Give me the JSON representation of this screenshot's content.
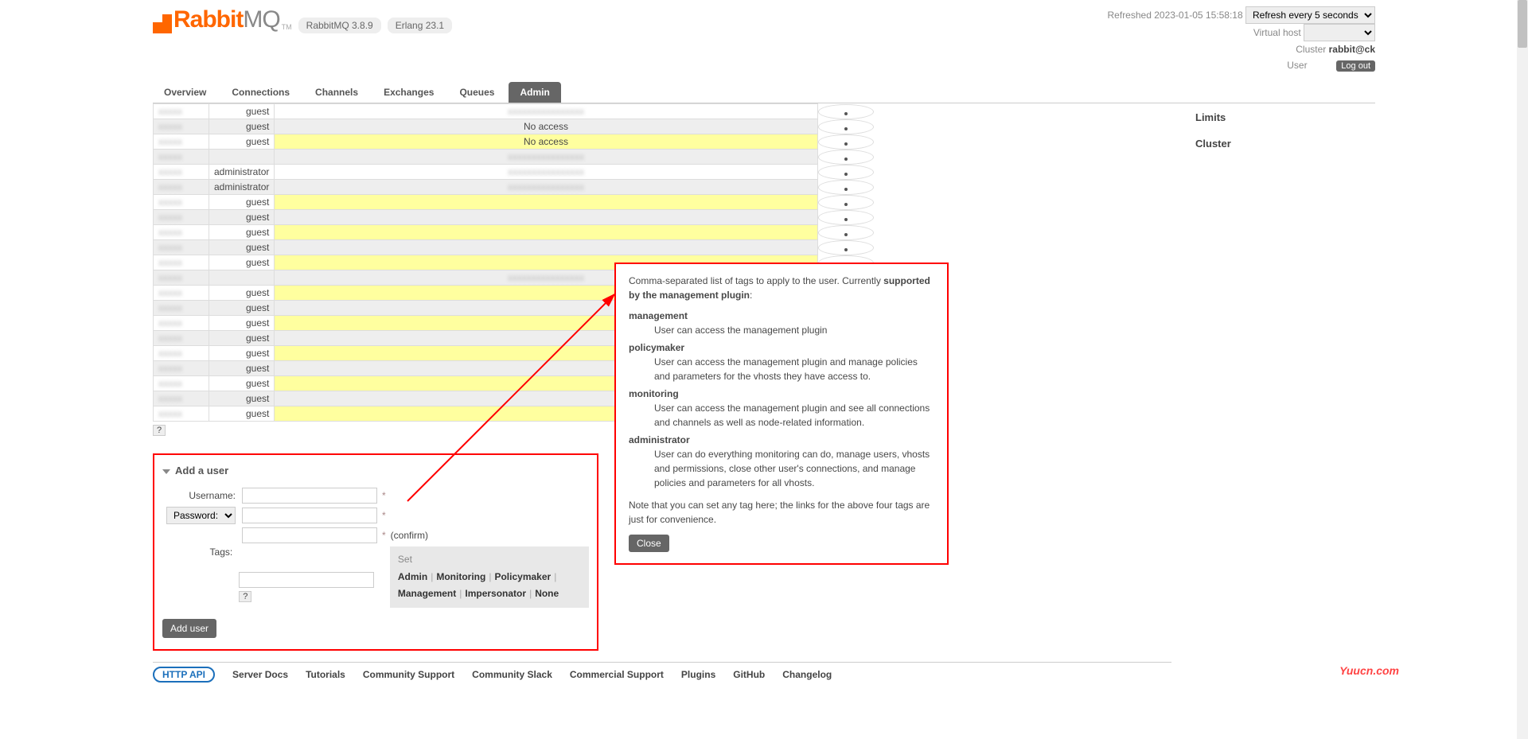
{
  "header": {
    "logo1": "Rabbit",
    "logo2": "MQ",
    "tm": "TM",
    "version": "RabbitMQ 3.8.9",
    "erlang": "Erlang 23.1"
  },
  "status": {
    "refreshed": "Refreshed 2023-01-05 15:58:18",
    "refresh_option": "Refresh every 5 seconds",
    "vhost_label": "Virtual host",
    "vhost_value": " ",
    "cluster_label": "Cluster",
    "cluster_value": "rabbit@ck",
    "user_label": "User",
    "user_value": " ",
    "logout": "Log out"
  },
  "tabs": [
    "Overview",
    "Connections",
    "Channels",
    "Exchanges",
    "Queues",
    "Admin"
  ],
  "active_tab": 5,
  "side_items": [
    "Limits",
    "Cluster"
  ],
  "rows": [
    {
      "tag": "guest",
      "access": "",
      "hi": false,
      "stripe": false,
      "blurredN": true,
      "blurredA": true
    },
    {
      "tag": "guest",
      "access": "No access",
      "hi": true,
      "stripe": true,
      "blurredN": true
    },
    {
      "tag": "guest",
      "access": "No access",
      "hi": true,
      "stripe": false,
      "blurredN": true
    },
    {
      "tag": "",
      "access": "",
      "hi": false,
      "stripe": true,
      "blurredN": true,
      "blurredA": true
    },
    {
      "tag": "administrator",
      "access": "",
      "hi": false,
      "stripe": false,
      "blurredN": true,
      "blurredA": true
    },
    {
      "tag": "administrator",
      "access": "",
      "hi": false,
      "stripe": true,
      "blurredN": true,
      "blurredA": true
    },
    {
      "tag": "guest",
      "access": "",
      "hi": true,
      "stripe": false,
      "blurredN": true
    },
    {
      "tag": "guest",
      "access": "",
      "hi": true,
      "stripe": true,
      "blurredN": true
    },
    {
      "tag": "guest",
      "access": "",
      "hi": true,
      "stripe": false,
      "blurredN": true
    },
    {
      "tag": "guest",
      "access": "",
      "hi": true,
      "stripe": true,
      "blurredN": true
    },
    {
      "tag": "guest",
      "access": "",
      "hi": true,
      "stripe": false,
      "blurredN": true
    },
    {
      "tag": "",
      "access": "",
      "hi": false,
      "stripe": true,
      "blurredN": true,
      "blurredA": true
    },
    {
      "tag": "guest",
      "access": "",
      "hi": true,
      "stripe": false,
      "blurredN": true
    },
    {
      "tag": "guest",
      "access": "",
      "hi": true,
      "stripe": true,
      "blurredN": true
    },
    {
      "tag": "guest",
      "access": "",
      "hi": true,
      "stripe": false,
      "blurredN": true
    },
    {
      "tag": "guest",
      "access": "",
      "hi": true,
      "stripe": true,
      "blurredN": true
    },
    {
      "tag": "guest",
      "access": "",
      "hi": true,
      "stripe": false,
      "blurredN": true
    },
    {
      "tag": "guest",
      "access": "",
      "hi": true,
      "stripe": true,
      "blurredN": true
    },
    {
      "tag": "guest",
      "access": "",
      "hi": true,
      "stripe": false,
      "blurredN": true
    },
    {
      "tag": "guest",
      "access": "",
      "hi": true,
      "stripe": true,
      "blurredN": true
    },
    {
      "tag": "guest",
      "access": "",
      "hi": true,
      "stripe": false,
      "blurredN": true
    }
  ],
  "help": "?",
  "add_user": {
    "title": "Add a user",
    "username_lbl": "Username:",
    "password_lbl": "Password:",
    "password_option": "Password:",
    "confirm": "(confirm)",
    "tags_lbl": "Tags:",
    "set": "Set",
    "tag_links": [
      "Admin",
      "Monitoring",
      "Policymaker",
      "Management",
      "Impersonator",
      "None"
    ],
    "help_q": "?",
    "button": "Add user"
  },
  "tooltip": {
    "intro1": "Comma-separated list of tags to apply to the user. Currently ",
    "intro_bold": "supported by the management plugin",
    "intro2": ":",
    "tags": [
      {
        "name": "management",
        "desc": "User can access the management plugin"
      },
      {
        "name": "policymaker",
        "desc": "User can access the management plugin and manage policies and parameters for the vhosts they have access to."
      },
      {
        "name": "monitoring",
        "desc": "User can access the management plugin and see all connections and channels as well as node-related information."
      },
      {
        "name": "administrator",
        "desc": "User can do everything monitoring can do, manage users, vhosts and permissions, close other user's connections, and manage policies and parameters for all vhosts."
      }
    ],
    "note": "Note that you can set any tag here; the links for the above four tags are just for convenience.",
    "close": "Close"
  },
  "footer": [
    "HTTP API",
    "Server Docs",
    "Tutorials",
    "Community Support",
    "Community Slack",
    "Commercial Support",
    "Plugins",
    "GitHub",
    "Changelog"
  ],
  "watermark": "Yuucn.com"
}
